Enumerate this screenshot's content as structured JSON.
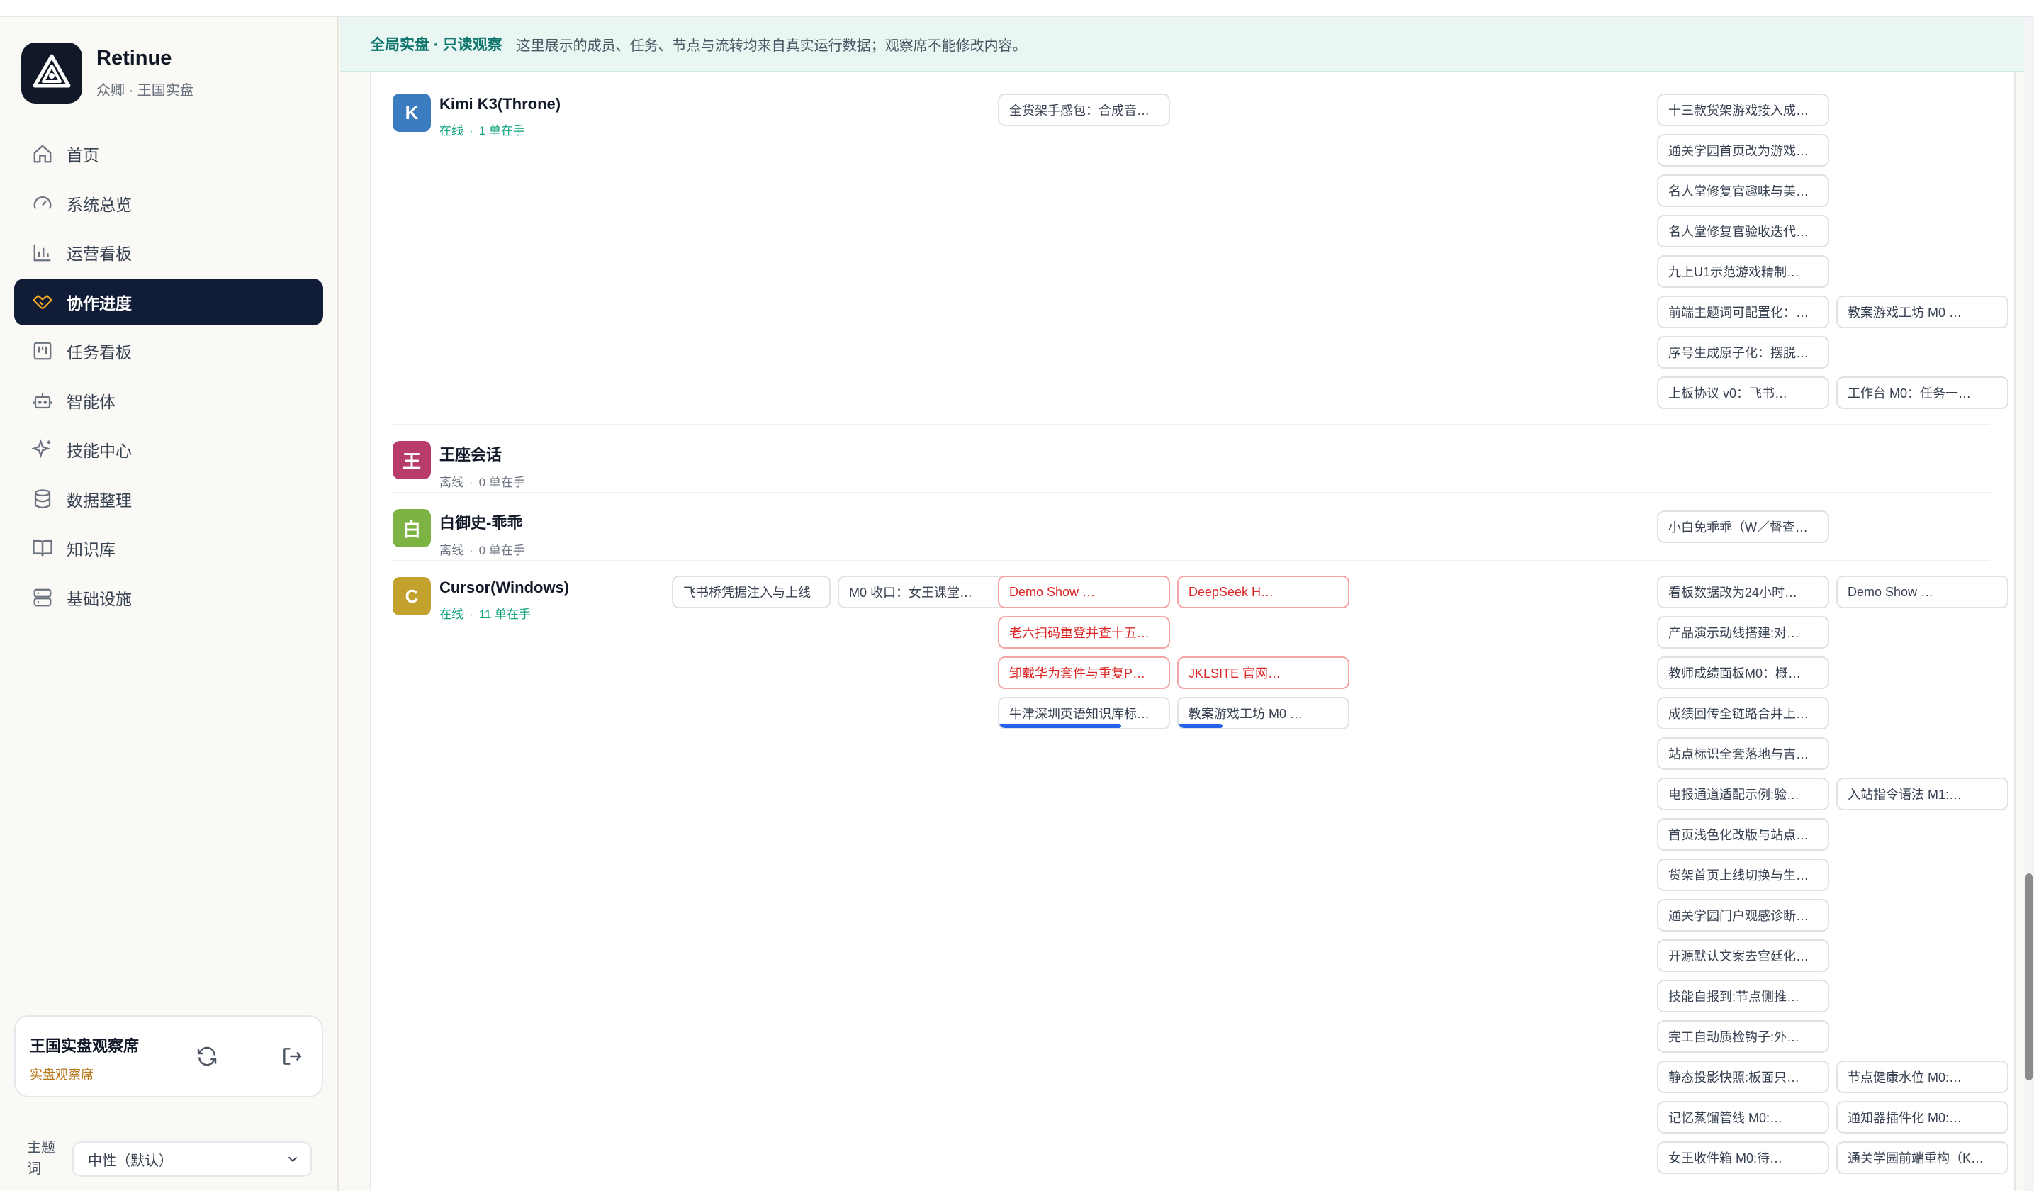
{
  "brand": {
    "name": "Retinue",
    "sub": "众卿 · 王国实盘"
  },
  "nav": [
    {
      "label": "首页",
      "icon": "home-icon"
    },
    {
      "label": "系统总览",
      "icon": "gauge-icon"
    },
    {
      "label": "运营看板",
      "icon": "bar-chart-icon"
    },
    {
      "label": "协作进度",
      "icon": "handshake-icon",
      "active": true
    },
    {
      "label": "任务看板",
      "icon": "kanban-icon"
    },
    {
      "label": "智能体",
      "icon": "bot-icon"
    },
    {
      "label": "技能中心",
      "icon": "sparkles-icon"
    },
    {
      "label": "数据整理",
      "icon": "database-icon"
    },
    {
      "label": "知识库",
      "icon": "book-icon"
    },
    {
      "label": "基础设施",
      "icon": "server-icon"
    }
  ],
  "observer": {
    "title": "王国实盘观察席",
    "sub": "实盘观察席"
  },
  "theme": {
    "label": "主题词",
    "value": "中性（默认）"
  },
  "banner": {
    "tag": "全局实盘 · 只读观察",
    "text": "这里展示的成员、任务、节点与流转均来自真实运行数据；观察席不能修改内容。"
  },
  "colors": {
    "accent": "#0f766e",
    "active_nav": "#111d36",
    "danger": "#dc2626",
    "progress": "#2563eb"
  },
  "members": [
    {
      "initial": "K",
      "name": "Kimi K3(Throne)",
      "state": "在线",
      "sep": "·",
      "count": "1 单在手",
      "color": "#3b7bbf",
      "col1": [],
      "col2": [
        {
          "label": "全货架手感包：合成音…"
        }
      ],
      "col3": [
        [
          "十三款货架游戏接入成…"
        ],
        [
          "通关学园首页改为游戏…"
        ],
        [
          "名人堂修复官趣味与美…"
        ],
        [
          "名人堂修复官验收迭代…"
        ],
        [
          "九上U1示范游戏精制…"
        ],
        [
          "前端主题词可配置化：…",
          "教案游戏工坊 M0 …"
        ],
        [
          "序号生成原子化：摆脱…"
        ],
        [
          "上板协议 v0：飞书…",
          "工作台 M0：任务一…"
        ]
      ]
    },
    {
      "initial": "王",
      "name": "王座会话",
      "state": "离线",
      "sep": "·",
      "count": "0 单在手",
      "color": "#b83c6a",
      "col1": [],
      "col2": [],
      "col3": []
    },
    {
      "initial": "白",
      "name": "白御史-乖乖",
      "state": "离线",
      "sep": "·",
      "count": "0 单在手",
      "color": "#7cb342",
      "col1": [],
      "col2": [],
      "col3": [
        [
          "小白免乖乖（W／督查…"
        ]
      ]
    },
    {
      "initial": "C",
      "name": "Cursor(Windows)",
      "state": "在线",
      "sep": "·",
      "count": "11 单在手",
      "color": "#c2a12e",
      "col1": [
        "飞书桥凭据注入与上线",
        "M0 收口：女王课堂…"
      ],
      "col2": [
        [
          {
            "label": "Demo Show …",
            "red": true
          },
          {
            "label": "DeepSeek H…",
            "red": true
          }
        ],
        [
          {
            "label": "老六扫码重登并查十五…",
            "red": true
          }
        ],
        [
          {
            "label": "卸载华为套件与重复P…",
            "red": true
          },
          {
            "label": "JKLSITE 官网…",
            "red": true
          }
        ],
        [
          {
            "label": "牛津深圳英语知识库标…",
            "progress": 0.72
          },
          {
            "label": "教案游戏工坊 M0 …",
            "progress": 0.26
          }
        ]
      ],
      "col3": [
        [
          "看板数据改为24小时…",
          "Demo Show …"
        ],
        [
          "产品演示动线搭建:对…"
        ],
        [
          "教师成绩面板M0：概…"
        ],
        [
          "成绩回传全链路合并上…"
        ],
        [
          "站点标识全套落地与吉…"
        ],
        [
          "电报通道适配示例:验…",
          "入站指令语法 M1:…"
        ],
        [
          "首页浅色化改版与站点…"
        ],
        [
          "货架首页上线切换与生…"
        ],
        [
          "通关学园门户观感诊断…"
        ],
        [
          "开源默认文案去宫廷化…"
        ],
        [
          "技能自报到:节点侧推…"
        ],
        [
          "完工自动质检钩子:外…"
        ],
        [
          "静态投影快照:板面只…",
          "节点健康水位 M0:…"
        ],
        [
          "记忆蒸馏管线 M0:…",
          "通知器插件化 M0:…"
        ],
        [
          "女王收件箱 M0:待…",
          "通关学园前端重构（K…"
        ]
      ]
    }
  ]
}
